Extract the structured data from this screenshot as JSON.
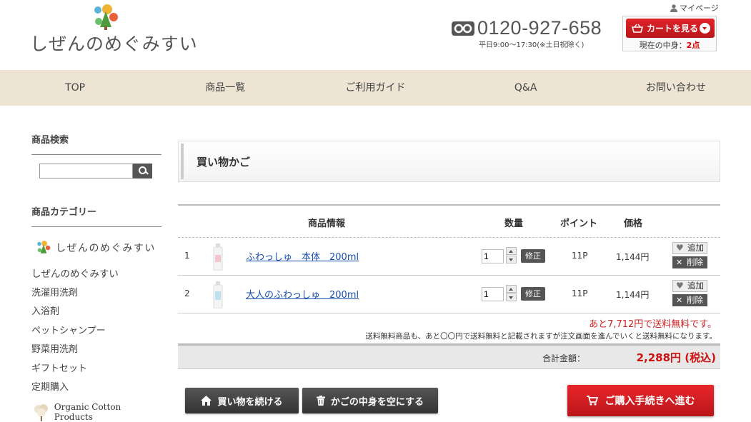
{
  "brand": {
    "name": "しぜんのめぐみすい",
    "colors": {
      "accent": "#d0161c",
      "nav_bg": "#ede4d3",
      "link": "#1a4fb0"
    }
  },
  "header": {
    "phone_number": "0120-927-658",
    "phone_hours": "平日9:00〜17:30(※土日祝除く)",
    "mypage_label": "マイページ",
    "cart_button_label": "カートを見る",
    "cart_status_prefix": "現在の中身：",
    "cart_status_count": "2点"
  },
  "nav": {
    "items": [
      "TOP",
      "商品一覧",
      "ご利用ガイド",
      "Q&A",
      "お問い合わせ"
    ]
  },
  "sidebar": {
    "search_heading": "商品検索",
    "search_value": "",
    "category_heading": "商品カテゴリー",
    "category_brand": "しぜんのめぐみすい",
    "categories": [
      "しぜんのめぐみすい",
      "洗濯用洗剤",
      "入浴剤",
      "ペットシャンプー",
      "野菜用洗剤",
      "ギフトセット",
      "定期購入"
    ],
    "organic_label": "Organic Cotton Products"
  },
  "main": {
    "page_title": "買い物かご",
    "columns": {
      "info": "商品情報",
      "qty": "数量",
      "points": "ポイント",
      "price": "価格"
    },
    "rows": [
      {
        "num": "1",
        "name": "ふわっしゅ　本体　200ml",
        "qty": "1",
        "fix_label": "修正",
        "points": "11P",
        "price": "1,144円",
        "fav_label": "追加",
        "del_label": "削除"
      },
      {
        "num": "2",
        "name": "大人のふわっしゅ　200ml",
        "qty": "1",
        "fix_label": "修正",
        "points": "11P",
        "price": "1,144円",
        "fav_label": "追加",
        "del_label": "削除"
      }
    ],
    "free_shipping_note": "あと7,712円で送料無料です。",
    "free_shipping_sub": "送料無料商品も、あと〇〇円で送料無料と記載されますが注文画面を進んでいくと送料無料になります。",
    "total_label": "合計金額：",
    "total_value": "2,288円 (税込)",
    "continue_label": "買い物を続ける",
    "empty_label": "かごの中身を空にする",
    "checkout_label": "ご購入手続きへ進む"
  }
}
